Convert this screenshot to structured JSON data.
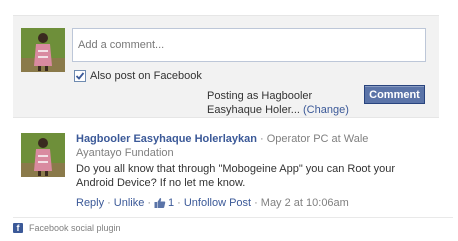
{
  "compose": {
    "placeholder": "Add a comment...",
    "also_post_label": "Also post on Facebook",
    "also_post_checked": true,
    "posting_as_prefix": "Posting as Hagbooler Easyhaque Holer...",
    "change_label": "(Change)",
    "comment_button_label": "Comment"
  },
  "comment": {
    "author": "Hagbooler Easyhaque Holerlaykan",
    "author_meta": "· Operator PC at Wale Ayantayo Fundation",
    "text": "Do you all know that through \"Mobogeine App\" you can Root your Android Device? If no let me know.",
    "reply_label": "Reply",
    "unlike_label": "Unlike",
    "like_count": "1",
    "unfollow_label": "Unfollow Post",
    "timestamp": "May 2 at 10:06am"
  },
  "footer": {
    "icon_letter": "f",
    "label": "Facebook social plugin"
  },
  "colors": {
    "link": "#3b5998",
    "button_bg": "#5b74a8",
    "panel_bg": "#f2f2f2"
  },
  "icons": [
    "avatar-photo",
    "checkbox-check-icon",
    "thumbs-up-icon",
    "facebook-icon"
  ]
}
